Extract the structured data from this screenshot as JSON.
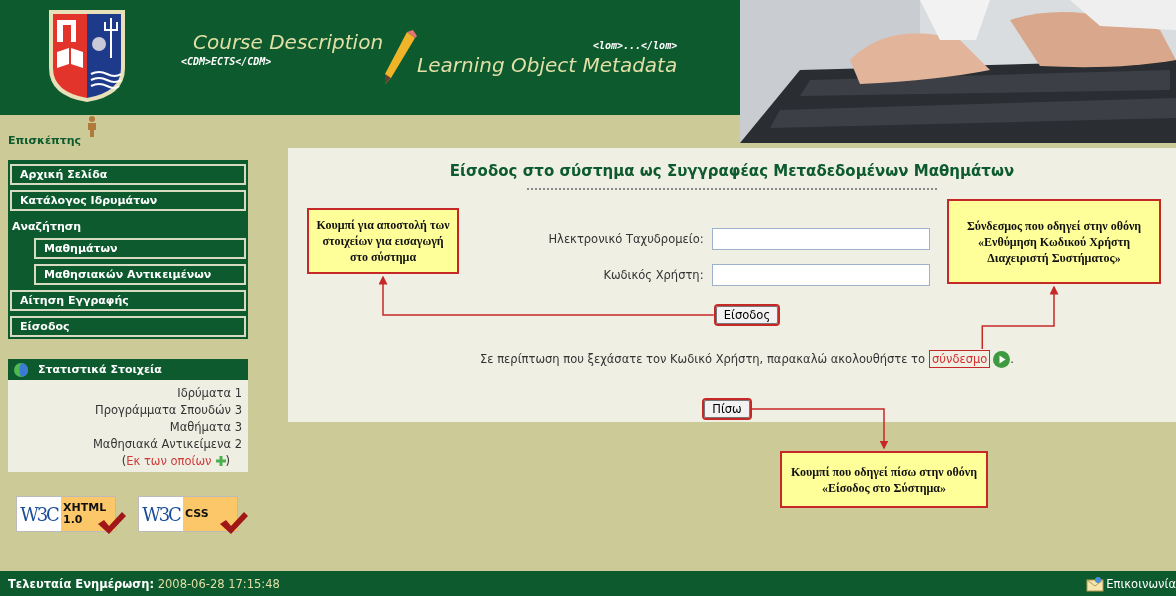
{
  "header": {
    "course_title": "Course Description",
    "course_tag": "<CDM>ECTS</CDM>",
    "lom_tag": "<lom>...</lom>",
    "lom_title": "Learning Object Metadata"
  },
  "user": {
    "role": "Επισκέπτης"
  },
  "sidebar": {
    "items": [
      {
        "kind": "link",
        "label": "Αρχική Σελίδα"
      },
      {
        "kind": "link",
        "label": "Κατάλογος Ιδρυμάτων"
      },
      {
        "kind": "heading",
        "label": "Αναζήτηση",
        "children": [
          {
            "kind": "link",
            "label": "Μαθημάτων"
          },
          {
            "kind": "link",
            "label": "Μαθησιακών Αντικειμένων"
          }
        ]
      },
      {
        "kind": "link",
        "label": "Αίτηση Εγγραφής"
      },
      {
        "kind": "link",
        "label": "Είσοδος"
      }
    ],
    "stats": {
      "title": "Στατιστικά Στοιχεία",
      "rows": [
        "Ιδρύματα 1",
        "Προγράμματα Σπουδών 3",
        "Μαθήματα 3",
        "Μαθησιακά Αντικείμενα 2"
      ],
      "more": {
        "open": "(",
        "label": "Εκ των οποίων",
        "close": ")"
      }
    },
    "badges": [
      {
        "brand": "W3C",
        "label": "XHTML",
        "version": "1.0"
      },
      {
        "brand": "W3C",
        "label": "CSS"
      }
    ]
  },
  "login": {
    "title": "Είσοδος στο σύστημα ως Συγγραφέας Μεταδεδομένων Μαθημάτων",
    "fields": [
      {
        "label": "Ηλεκτρονικό Ταχυδρομείο:"
      },
      {
        "label": "Κωδικός Χρήστη:"
      }
    ],
    "submit": "Είσοδος",
    "forgot": {
      "before": "Σε περίπτωση που ξεχάσατε τον Κωδικό Χρήστη, παρακαλώ ακολουθήστε το",
      "link": "σύνδεσμο",
      "after": "."
    },
    "back": "Πίσω"
  },
  "callouts": [
    {
      "text": "Κουμπί για αποστολή των στοιχείων για εισαγωγή στο σύστημα"
    },
    {
      "text": "Σύνδεσμος που οδηγεί στην οθόνη «Ενθύμηση Κωδικού Χρήστη Διαχειριστή Συστήματος»"
    },
    {
      "text": "Κουμπί που οδηγεί πίσω στην οθόνη «Είσοδος στο Σύστημα»"
    }
  ],
  "footer": {
    "updated_label": "Τελευταία Ενημέρωση:",
    "updated_value": "2008-06-28 17:15:48",
    "contact": "Επικοινωνία"
  }
}
